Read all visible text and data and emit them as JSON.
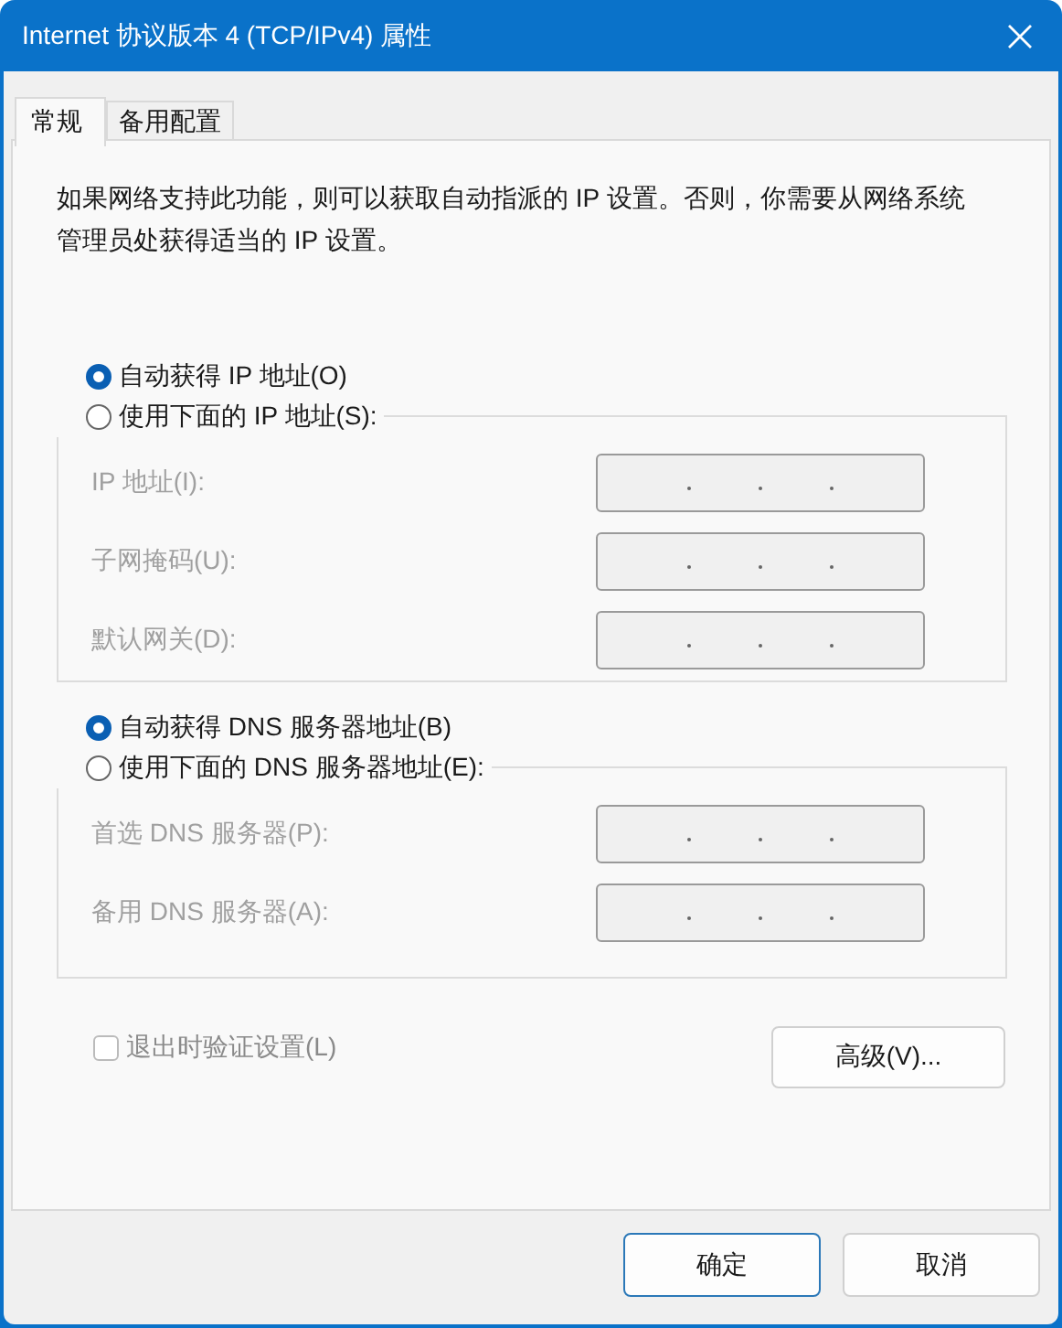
{
  "window": {
    "title": "Internet 协议版本 4 (TCP/IPv4) 属性"
  },
  "tabs": [
    {
      "label": "常规",
      "selected": true
    },
    {
      "label": "备用配置",
      "selected": false
    }
  ],
  "description": "如果网络支持此功能，则可以获取自动指派的 IP 设置。否则，你需要从网络系统管理员处获得适当的 IP 设置。",
  "ip_section": {
    "auto_option": {
      "label": "自动获得 IP 地址(O)",
      "selected": true
    },
    "manual_option": {
      "label": "使用下面的 IP 地址(S):",
      "selected": false
    },
    "fields": [
      {
        "label": "IP 地址(I):",
        "disabled": true
      },
      {
        "label": "子网掩码(U):",
        "disabled": true
      },
      {
        "label": "默认网关(D):",
        "disabled": true
      }
    ]
  },
  "dns_section": {
    "auto_option": {
      "label": "自动获得 DNS 服务器地址(B)",
      "selected": true
    },
    "manual_option": {
      "label": "使用下面的 DNS 服务器地址(E):",
      "selected": false
    },
    "fields": [
      {
        "label": "首选 DNS 服务器(P):",
        "disabled": true
      },
      {
        "label": "备用 DNS 服务器(A):",
        "disabled": true
      }
    ]
  },
  "validate_checkbox": {
    "label": "退出时验证设置(L)",
    "checked": false,
    "disabled": true
  },
  "advanced_button": "高级(V)...",
  "buttons": [
    {
      "label": "确定",
      "default": true
    },
    {
      "label": "取消",
      "default": false
    }
  ]
}
